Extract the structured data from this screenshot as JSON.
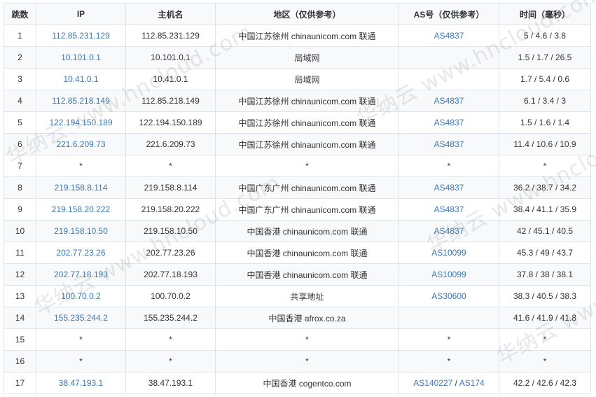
{
  "columns": [
    "跳数",
    "IP",
    "主机名",
    "地区（仅供参考）",
    "AS号（仅供参考）",
    "时间（毫秒）"
  ],
  "rows": [
    {
      "hop": "1",
      "ip": "112.85.231.129",
      "host": "112.85.231.129",
      "region": "中国江苏徐州 chinaunicom.com 联通",
      "as": [
        "AS4837"
      ],
      "time": "5 / 4.6 / 3.8"
    },
    {
      "hop": "2",
      "ip": "10.101.0.1",
      "host": "10.101.0.1",
      "region": "局域网",
      "as": [],
      "time": "1.5 / 1.7 / 26.5"
    },
    {
      "hop": "3",
      "ip": "10.41.0.1",
      "host": "10.41.0.1",
      "region": "局域网",
      "as": [],
      "time": "1.7 / 5.4 / 0.6"
    },
    {
      "hop": "4",
      "ip": "112.85.218.149",
      "host": "112.85.218.149",
      "region": "中国江苏徐州 chinaunicom.com 联通",
      "as": [
        "AS4837"
      ],
      "time": "6.1 / 3.4 / 3"
    },
    {
      "hop": "5",
      "ip": "122.194.150.189",
      "host": "122.194.150.189",
      "region": "中国江苏徐州 chinaunicom.com 联通",
      "as": [
        "AS4837"
      ],
      "time": "1.5 / 1.6 / 1.4"
    },
    {
      "hop": "6",
      "ip": "221.6.209.73",
      "host": "221.6.209.73",
      "region": "中国江苏徐州 chinaunicom.com 联通",
      "as": [
        "AS4837"
      ],
      "time": "11.4 / 10.6 / 10.9"
    },
    {
      "hop": "7",
      "ip": "*",
      "host": "*",
      "region": "*",
      "as_text": "*",
      "as": [],
      "time": "*"
    },
    {
      "hop": "8",
      "ip": "219.158.8.114",
      "host": "219.158.8.114",
      "region": "中国广东广州 chinaunicom.com 联通",
      "as": [
        "AS4837"
      ],
      "time": "36.2 / 38.7 / 34.2"
    },
    {
      "hop": "9",
      "ip": "219.158.20.222",
      "host": "219.158.20.222",
      "region": "中国广东广州 chinaunicom.com 联通",
      "as": [
        "AS4837"
      ],
      "time": "38.4 / 41.1 / 35.9"
    },
    {
      "hop": "10",
      "ip": "219.158.10.50",
      "host": "219.158.10.50",
      "region": "中国香港 chinaunicom.com 联通",
      "as": [
        "AS4837"
      ],
      "time": "42 / 45.1 / 40.5"
    },
    {
      "hop": "11",
      "ip": "202.77.23.26",
      "host": "202.77.23.26",
      "region": "中国香港 chinaunicom.com 联通",
      "as": [
        "AS10099"
      ],
      "time": "45.3 / 49 / 43.7"
    },
    {
      "hop": "12",
      "ip": "202.77.18.193",
      "host": "202.77.18.193",
      "region": "中国香港 chinaunicom.com 联通",
      "as": [
        "AS10099"
      ],
      "time": "37.8 / 38 / 38.1"
    },
    {
      "hop": "13",
      "ip": "100.70.0.2",
      "host": "100.70.0.2",
      "region": "共享地址",
      "as": [
        "AS30600"
      ],
      "time": "38.3 / 40.5 / 38.3"
    },
    {
      "hop": "14",
      "ip": "155.235.244.2",
      "host": "155.235.244.2",
      "region": "中国香港 afrox.co.za",
      "as": [],
      "time": "41.6 / 41.9 / 41.8"
    },
    {
      "hop": "15",
      "ip": "*",
      "host": "*",
      "region": "*",
      "as_text": "*",
      "as": [],
      "time": "*"
    },
    {
      "hop": "16",
      "ip": "*",
      "host": "*",
      "region": "*",
      "as_text": "*",
      "as": [],
      "time": "*"
    },
    {
      "hop": "17",
      "ip": "38.47.193.1",
      "host": "38.47.193.1",
      "region": "中国香港 cogentco.com",
      "as": [
        "AS140227",
        "AS174"
      ],
      "time": "42.2 / 42.6 / 42.3"
    }
  ],
  "watermark": "华纳云 www.hncloud.com",
  "colors": {
    "link": "#3c79b6",
    "header_bg": "#f7f9fb",
    "border": "#dde3ea"
  }
}
